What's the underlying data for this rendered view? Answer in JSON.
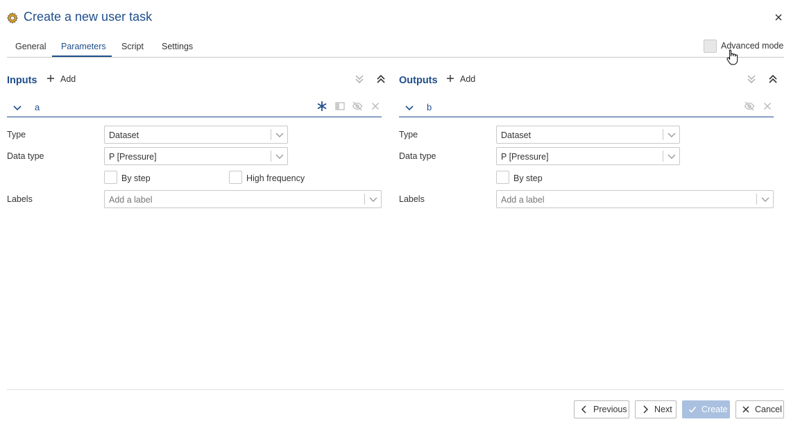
{
  "dialog": {
    "title": "Create a new user task",
    "close_icon": "close-icon",
    "title_icon": "gear-icon"
  },
  "tabs": [
    {
      "label": "General",
      "active": false
    },
    {
      "label": "Parameters",
      "active": true
    },
    {
      "label": "Script",
      "active": false
    },
    {
      "label": "Settings",
      "active": false
    }
  ],
  "advanced_mode": {
    "label": "Advanced mode",
    "checked": false
  },
  "inputs": {
    "title": "Inputs",
    "add_label": "Add",
    "param": {
      "name": "a",
      "type_label": "Type",
      "type_value": "Dataset",
      "data_type_label": "Data type",
      "data_type_value": "P [Pressure]",
      "by_step_label": "By step",
      "high_frequency_label": "High frequency",
      "labels_label": "Labels",
      "labels_placeholder": "Add a label"
    }
  },
  "outputs": {
    "title": "Outputs",
    "add_label": "Add",
    "param": {
      "name": "b",
      "type_label": "Type",
      "type_value": "Dataset",
      "data_type_label": "Data type",
      "data_type_value": "P [Pressure]",
      "by_step_label": "By step",
      "labels_label": "Labels",
      "labels_placeholder": "Add a label"
    }
  },
  "footer": {
    "previous_label": "Previous",
    "next_label": "Next",
    "create_label": "Create",
    "cancel_label": "Cancel"
  },
  "colors": {
    "accent": "#1f4e8c",
    "border": "#c8c8c8",
    "create_disabled": "#a9c0e0"
  }
}
